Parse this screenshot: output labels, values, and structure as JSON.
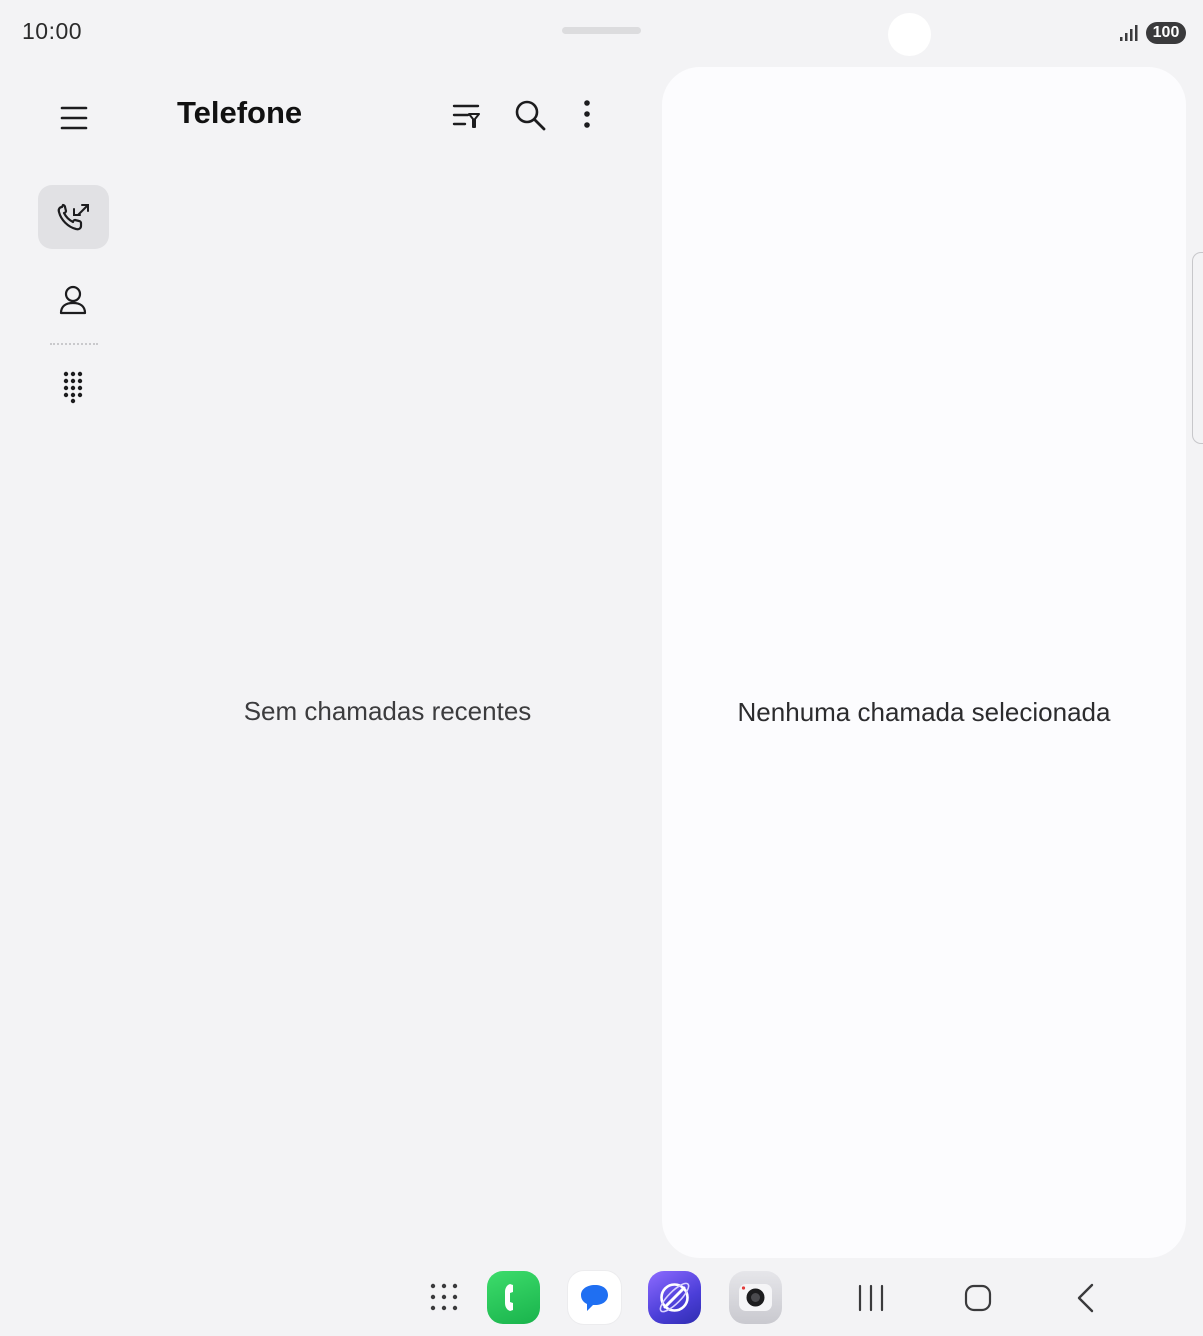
{
  "status_bar": {
    "time": "10:00",
    "battery_level": "100",
    "icons": [
      "signal-icon",
      "battery-icon"
    ]
  },
  "header": {
    "title": "Telefone",
    "icons": [
      "menu-icon",
      "filter-icon",
      "search-icon",
      "more-vert-icon"
    ]
  },
  "nav_rail": {
    "items": [
      {
        "id": "recents",
        "icon": "call-log-icon",
        "selected": true
      },
      {
        "id": "contacts",
        "icon": "person-icon",
        "selected": false
      },
      {
        "id": "keypad",
        "icon": "dialpad-icon",
        "selected": false
      }
    ]
  },
  "main": {
    "empty_message": "Sem chamadas recentes"
  },
  "detail": {
    "empty_message": "Nenhuma chamada selecionada"
  },
  "taskbar": {
    "apps": [
      "apps-grid-icon",
      "phone-app-icon",
      "messages-app-icon",
      "internet-app-icon",
      "camera-app-icon"
    ],
    "nav": [
      "recent-apps-icon",
      "home-icon",
      "back-icon"
    ]
  },
  "colors": {
    "background": "#f3f3f5",
    "panel": "#fcfcfe",
    "selected_nav": "#e1e1e4"
  }
}
